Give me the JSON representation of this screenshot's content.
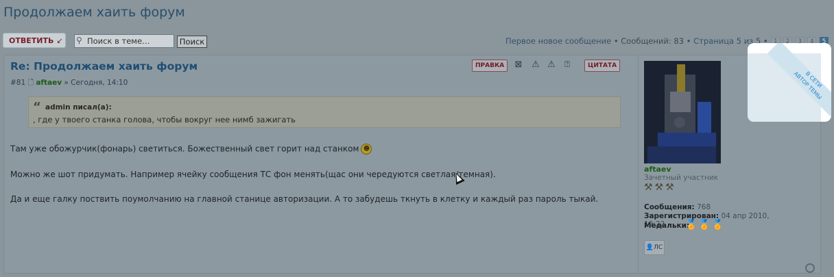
{
  "thread": {
    "title": "Продолжаем хаить форум"
  },
  "toolbar": {
    "reply_label": "ОТВЕТИТЬ",
    "search_placeholder": "Поиск в теме…",
    "search_button": "Поиск"
  },
  "pager": {
    "first_new": "Первое новое сообщение",
    "posts_count": "Сообщений: 83",
    "page_info": "Страница 5 из 5",
    "pages": [
      "1",
      "2",
      "3",
      "4",
      "5"
    ],
    "current_page": "5"
  },
  "post": {
    "title": "Re: Продолжаем хаить форум",
    "number": "#81",
    "author": "aftaev",
    "time": "» Сегодня, 14:10",
    "actions": {
      "edit": "ПРАВКА",
      "quote": "ЦИТАТА"
    },
    "quote": {
      "author": "admin писал(а):",
      "text": ", где у твоего станка голова, чтобы вокруг нее нимб зажигать"
    },
    "lines": [
      "Там уже обожурчик(фонарь) светиться. Божественный свет горит над станком",
      "Можно же шот придумать. Например ячейку сообщения ТС фон менять(щас они чередуются светлая/темная).",
      "Да и еще галку поствить поумолчанию на главной станице авторизации. А то забудешь ткнуть в клетку и каждый раз пароль тыкай."
    ]
  },
  "profile": {
    "name": "aftaev",
    "rank": "Зачетный участник",
    "posts_label": "Сообщения:",
    "posts_value": "768",
    "registered_label": "Зарегистрирован:",
    "registered_value": "04 апр 2010, 19:22",
    "medals_label": "Медальки:",
    "pm_label": "ЛС"
  },
  "badge": {
    "online": "В СЕТИ",
    "author": "АВТОР ТЕМЫ"
  }
}
